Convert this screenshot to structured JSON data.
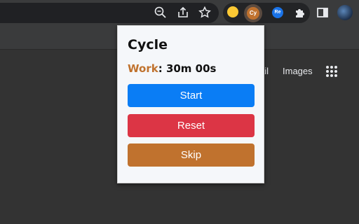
{
  "toolbar": {
    "icons": [
      "zoom-icon",
      "share-icon",
      "bookmark-star-icon",
      "puzzle-icon",
      "sidepanel-icon",
      "profile-avatar"
    ],
    "extensions": [
      {
        "name": "yellow-extension",
        "label": ""
      },
      {
        "name": "cycle-extension",
        "label": "Cy"
      },
      {
        "name": "re-extension",
        "label": "Re"
      }
    ]
  },
  "page": {
    "links": [
      "ail",
      "Images"
    ]
  },
  "popup": {
    "title": "Cycle",
    "status": {
      "mode": "Work",
      "separator": ":",
      "time": "30m 00s"
    },
    "buttons": {
      "start": "Start",
      "reset": "Reset",
      "skip": "Skip"
    },
    "colors": {
      "start": "#0a7df5",
      "reset": "#dc3545",
      "skip": "#c0722e",
      "mode": "#c0722e"
    }
  }
}
